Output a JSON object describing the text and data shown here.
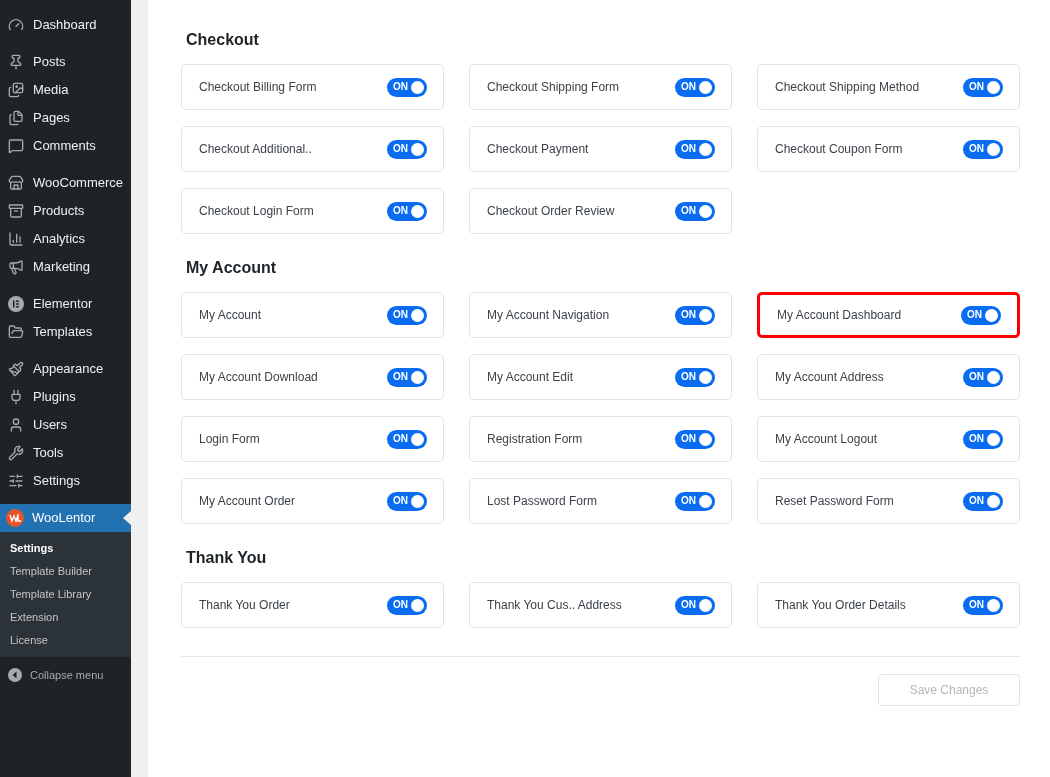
{
  "sidebar": {
    "groups": [
      [
        {
          "label": "Dashboard"
        }
      ],
      [
        {
          "label": "Posts"
        },
        {
          "label": "Media"
        },
        {
          "label": "Pages"
        },
        {
          "label": "Comments"
        }
      ],
      [
        {
          "label": "WooCommerce"
        },
        {
          "label": "Products"
        },
        {
          "label": "Analytics"
        },
        {
          "label": "Marketing"
        }
      ],
      [
        {
          "label": "Elementor"
        },
        {
          "label": "Templates"
        }
      ],
      [
        {
          "label": "Appearance"
        },
        {
          "label": "Plugins"
        },
        {
          "label": "Users"
        },
        {
          "label": "Tools"
        },
        {
          "label": "Settings"
        }
      ]
    ],
    "active_item": {
      "label": "WooLentor",
      "selected": true
    },
    "submenu": [
      {
        "label": "Settings",
        "selected": true
      },
      {
        "label": "Template Builder",
        "selected": false
      },
      {
        "label": "Template Library",
        "selected": false
      },
      {
        "label": "Extension",
        "selected": false
      },
      {
        "label": "License",
        "selected": false
      }
    ],
    "collapse": "Collapse menu"
  },
  "sections": [
    {
      "title": "Checkout",
      "items": [
        {
          "label": "Checkout Billing Form",
          "toggle_label": "ON",
          "on": true,
          "highlighted": false
        },
        {
          "label": "Checkout Shipping Form",
          "toggle_label": "ON",
          "on": true,
          "highlighted": false
        },
        {
          "label": "Checkout Shipping Method",
          "toggle_label": "ON",
          "on": true,
          "highlighted": false
        },
        {
          "label": "Checkout Additional..",
          "toggle_label": "ON",
          "on": true,
          "highlighted": false
        },
        {
          "label": "Checkout Payment",
          "toggle_label": "ON",
          "on": true,
          "highlighted": false
        },
        {
          "label": "Checkout Coupon Form",
          "toggle_label": "ON",
          "on": true,
          "highlighted": false
        },
        {
          "label": "Checkout Login Form",
          "toggle_label": "ON",
          "on": true,
          "highlighted": false
        },
        {
          "label": "Checkout Order Review",
          "toggle_label": "ON",
          "on": true,
          "highlighted": false
        }
      ]
    },
    {
      "title": "My Account",
      "items": [
        {
          "label": "My Account",
          "toggle_label": "ON",
          "on": true,
          "highlighted": false
        },
        {
          "label": "My Account Navigation",
          "toggle_label": "ON",
          "on": true,
          "highlighted": false
        },
        {
          "label": "My Account Dashboard",
          "toggle_label": "ON",
          "on": true,
          "highlighted": true
        },
        {
          "label": "My Account Download",
          "toggle_label": "ON",
          "on": true,
          "highlighted": false
        },
        {
          "label": "My Account Edit",
          "toggle_label": "ON",
          "on": true,
          "highlighted": false
        },
        {
          "label": "My Account Address",
          "toggle_label": "ON",
          "on": true,
          "highlighted": false
        },
        {
          "label": "Login Form",
          "toggle_label": "ON",
          "on": true,
          "highlighted": false
        },
        {
          "label": "Registration Form",
          "toggle_label": "ON",
          "on": true,
          "highlighted": false
        },
        {
          "label": "My Account Logout",
          "toggle_label": "ON",
          "on": true,
          "highlighted": false
        },
        {
          "label": "My Account Order",
          "toggle_label": "ON",
          "on": true,
          "highlighted": false
        },
        {
          "label": "Lost Password Form",
          "toggle_label": "ON",
          "on": true,
          "highlighted": false
        },
        {
          "label": "Reset Password Form",
          "toggle_label": "ON",
          "on": true,
          "highlighted": false
        }
      ]
    },
    {
      "title": "Thank You",
      "items": [
        {
          "label": "Thank You Order",
          "toggle_label": "ON",
          "on": true,
          "highlighted": false
        },
        {
          "label": "Thank You Cus.. Address",
          "toggle_label": "ON",
          "on": true,
          "highlighted": false
        },
        {
          "label": "Thank You Order Details",
          "toggle_label": "ON",
          "on": true,
          "highlighted": false
        }
      ]
    }
  ],
  "save_button": {
    "label": "Save Changes",
    "disabled": true
  }
}
